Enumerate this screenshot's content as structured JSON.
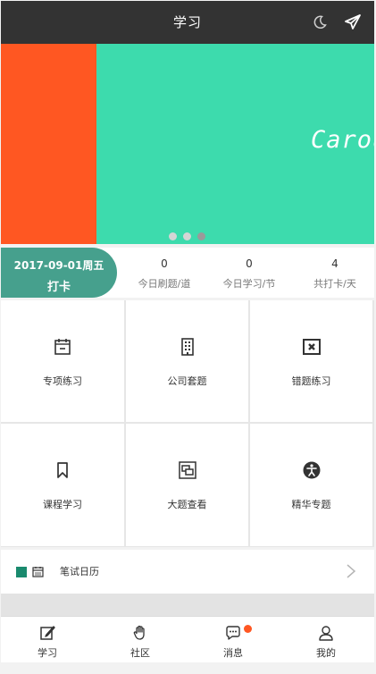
{
  "header": {
    "title": "学习",
    "moon_icon": "moon-icon",
    "send_icon": "paper-plane-icon"
  },
  "carousel": {
    "caption": "Carousel",
    "colors": {
      "left": "#ff5722",
      "main": "#3ddbad"
    },
    "dots": 3,
    "active_dot": 2
  },
  "stats": {
    "checkin_date": "2017-09-01周五",
    "checkin_label": "打卡",
    "items": [
      {
        "value": "0",
        "label": "今日刷题/道"
      },
      {
        "value": "0",
        "label": "今日学习/节"
      },
      {
        "value": "4",
        "label": "共打卡/天"
      }
    ]
  },
  "grid": [
    {
      "label": "专项练习",
      "icon": "calendar-icon"
    },
    {
      "label": "公司套题",
      "icon": "building-icon"
    },
    {
      "label": "错题练习",
      "icon": "x-box-icon"
    },
    {
      "label": "课程学习",
      "icon": "bookmark-icon"
    },
    {
      "label": "大题查看",
      "icon": "screens-icon"
    },
    {
      "label": "精华专题",
      "icon": "accessibility-icon"
    }
  ],
  "calendar_row": {
    "label": "笔试日历"
  },
  "tabbar": [
    {
      "label": "学习",
      "icon": "edit-icon"
    },
    {
      "label": "社区",
      "icon": "hand-icon"
    },
    {
      "label": "消息",
      "icon": "chat-icon"
    },
    {
      "label": "我的",
      "icon": "user-icon"
    }
  ],
  "colors": {
    "accent": "#46a08d",
    "header": "#333333",
    "badge": "#ff5722"
  }
}
